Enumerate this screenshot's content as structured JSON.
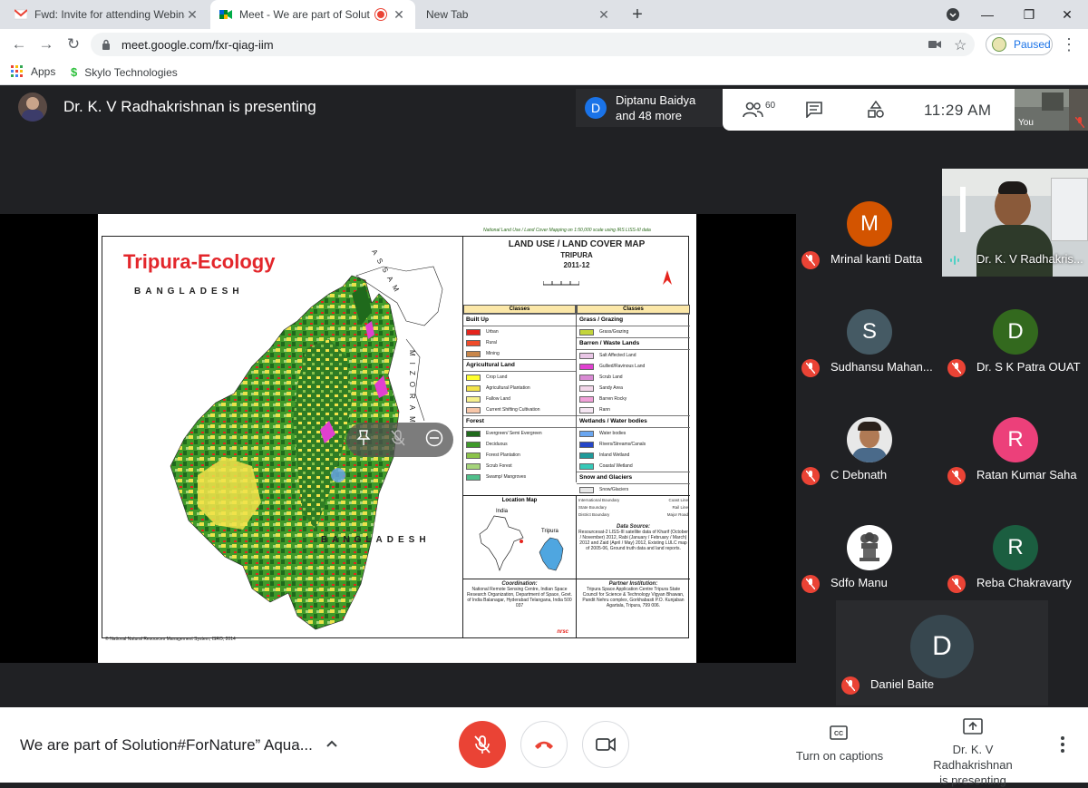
{
  "browser": {
    "tabs": [
      {
        "title": "Fwd: Invite for attending Webinar",
        "icon": "gmail-icon"
      },
      {
        "title": "Meet - We are part of Solution",
        "icon": "meet-icon",
        "recording": true
      },
      {
        "title": "New Tab",
        "icon": ""
      }
    ],
    "url": "meet.google.com/fxr-qiag-iim",
    "profile_status": "Paused",
    "bookmarks": [
      {
        "label": "Apps",
        "icon": "apps-grid-icon"
      },
      {
        "label": "Skylo Technologies",
        "icon": "skylo-icon"
      }
    ]
  },
  "meet": {
    "presenter_banner": "Dr. K. V Radhakrishnan is presenting",
    "host": {
      "initial": "D",
      "line1": "Diptanu Baidya",
      "line2": "and 48 more",
      "color": "#1a73e8"
    },
    "participant_count": "60",
    "time": "11:29  AM",
    "self_label": "You",
    "participants": [
      {
        "name": "Mrinal kanti Datta",
        "initial": "M",
        "color": "#d35400",
        "muted": true
      },
      {
        "name": "Dr. K. V Radhakris...",
        "initial": "",
        "color": "",
        "muted": false,
        "speaking": true,
        "video": true
      },
      {
        "name": "Sudhansu Mahan...",
        "initial": "S",
        "color": "#455a64",
        "muted": true
      },
      {
        "name": "Dr. S K Patra OUAT",
        "initial": "D",
        "color": "#33691e",
        "muted": true
      },
      {
        "name": "C Debnath",
        "initial": "",
        "color": "#e8e8e8",
        "muted": true,
        "photo": true
      },
      {
        "name": "Ratan Kumar Saha",
        "initial": "R",
        "color": "#ec407a",
        "muted": true
      },
      {
        "name": "Sdfo Manu",
        "initial": "",
        "color": "#ffffff",
        "muted": true,
        "emblem": true
      },
      {
        "name": "Reba Chakravarty",
        "initial": "R",
        "color": "#1b5e40",
        "muted": true
      },
      {
        "name": "Daniel Baite",
        "initial": "D",
        "color": "#37474f",
        "muted": true
      }
    ],
    "meeting_title": "We are part of Solution#ForNature” Aqua...",
    "captions_label": "Turn on captions",
    "present_state_line1": "Dr. K. V Radhakrishnan",
    "present_state_line2": "is presenting",
    "hangup_color": "#ea4335"
  },
  "slide": {
    "top_text": "National Land Use / Land Cover Mapping on 1:50,000 scale using IRS LISS-III data",
    "eco_title": "Tripura-Ecology",
    "bangladesh_top": "BANGLADESH",
    "bangladesh_bottom": "BANGLADESH",
    "assam": "ASSAM",
    "mizoram": "MIZORAM",
    "map_title": "LAND USE / LAND COVER MAP",
    "map_state": "TRIPURA",
    "map_year": "2011-12",
    "classes_label": "Classes",
    "left_groups": [
      {
        "name": "Built Up",
        "items": [
          [
            "Urban",
            "#e5241d"
          ],
          [
            "Rural",
            "#f04b2a"
          ],
          [
            "Mining",
            "#c8864a"
          ]
        ]
      },
      {
        "name": "Agricultural Land",
        "items": [
          [
            "Crop Land",
            "#ffff2e"
          ],
          [
            "Agricultural Plantation",
            "#f2e34a"
          ],
          [
            "Fallow Land",
            "#f6f08c"
          ],
          [
            "Current Shifting Cultivation",
            "#f7c6a8"
          ]
        ]
      },
      {
        "name": "Forest",
        "items": [
          [
            "Evergreen/ Semi Evergreen",
            "#1f6a1c"
          ],
          [
            "Deciduous",
            "#3f9a2a"
          ],
          [
            "Forest Plantation",
            "#8bc34a"
          ],
          [
            "Scrub Forest",
            "#a5d47a"
          ],
          [
            "Swamp/ Mangroves",
            "#4fbf8a"
          ]
        ]
      }
    ],
    "right_groups": [
      {
        "name": "Grass / Grazing",
        "items": [
          [
            "Grass/Grazing",
            "#c3d43a"
          ]
        ]
      },
      {
        "name": "Barren / Waste Lands",
        "items": [
          [
            "Salt Affected Land",
            "#e9c6e6"
          ],
          [
            "Gullied/Ravinous Land",
            "#e040d0"
          ],
          [
            "Scrub Land",
            "#d98ad4"
          ],
          [
            "Sandy Area",
            "#f3d7ea"
          ],
          [
            "Barren Rocky",
            "#f0a0d8"
          ],
          [
            "Rann",
            "#f5e6f2"
          ]
        ]
      },
      {
        "name": "Wetlands / Water bodies",
        "items": [
          [
            "Water bodies",
            "#6aa6f0"
          ],
          [
            "Rivers/Streams/Canals",
            "#2446c8"
          ],
          [
            "Inland Wetland",
            "#1f9a9a"
          ],
          [
            "Coastal Wetland",
            "#36c9b8"
          ]
        ]
      },
      {
        "name": "Snow and Glaciers",
        "items": [
          [
            "Snow/Glaciers",
            "#e8e8e8"
          ]
        ]
      }
    ],
    "location_map_label": "Location Map",
    "india_label": "India",
    "tripura_label": "Tripura",
    "line_key": [
      "International Boundary",
      "Coast Line",
      "State Boundary",
      "Rail Line",
      "District Boundary",
      "Major Road"
    ],
    "data_source_title": "Data Source:",
    "data_source_text": "Resourcesat-2 LISS-III satellite data of Kharif (October / November) 2012, Rabi (January / February / March) 2012 and Zaid (April / May) 2012, Existing LULC map of 2005-06, Ground truth data and land reports.",
    "coordination_title": "Coordination:",
    "coordination_text": "National Remote Sensing Centre, Indian Space Research Organization, Department of Space, Govt. of India Balanagar, Hyderabad Telangana, India 500 037",
    "partner_title": "Partner Institution:",
    "partner_text": "Tripura Space Application Centre Tripura State Council for Science & Technology Vigyan Bhawan, Pandit Nehru complex, Gorkhabasti P.O. Kunjaban Agartala, Tripura, 799 006.",
    "nrsc_label": "nrsc",
    "footer": "© National Natural Resources Management System, ISRO, 2014"
  }
}
